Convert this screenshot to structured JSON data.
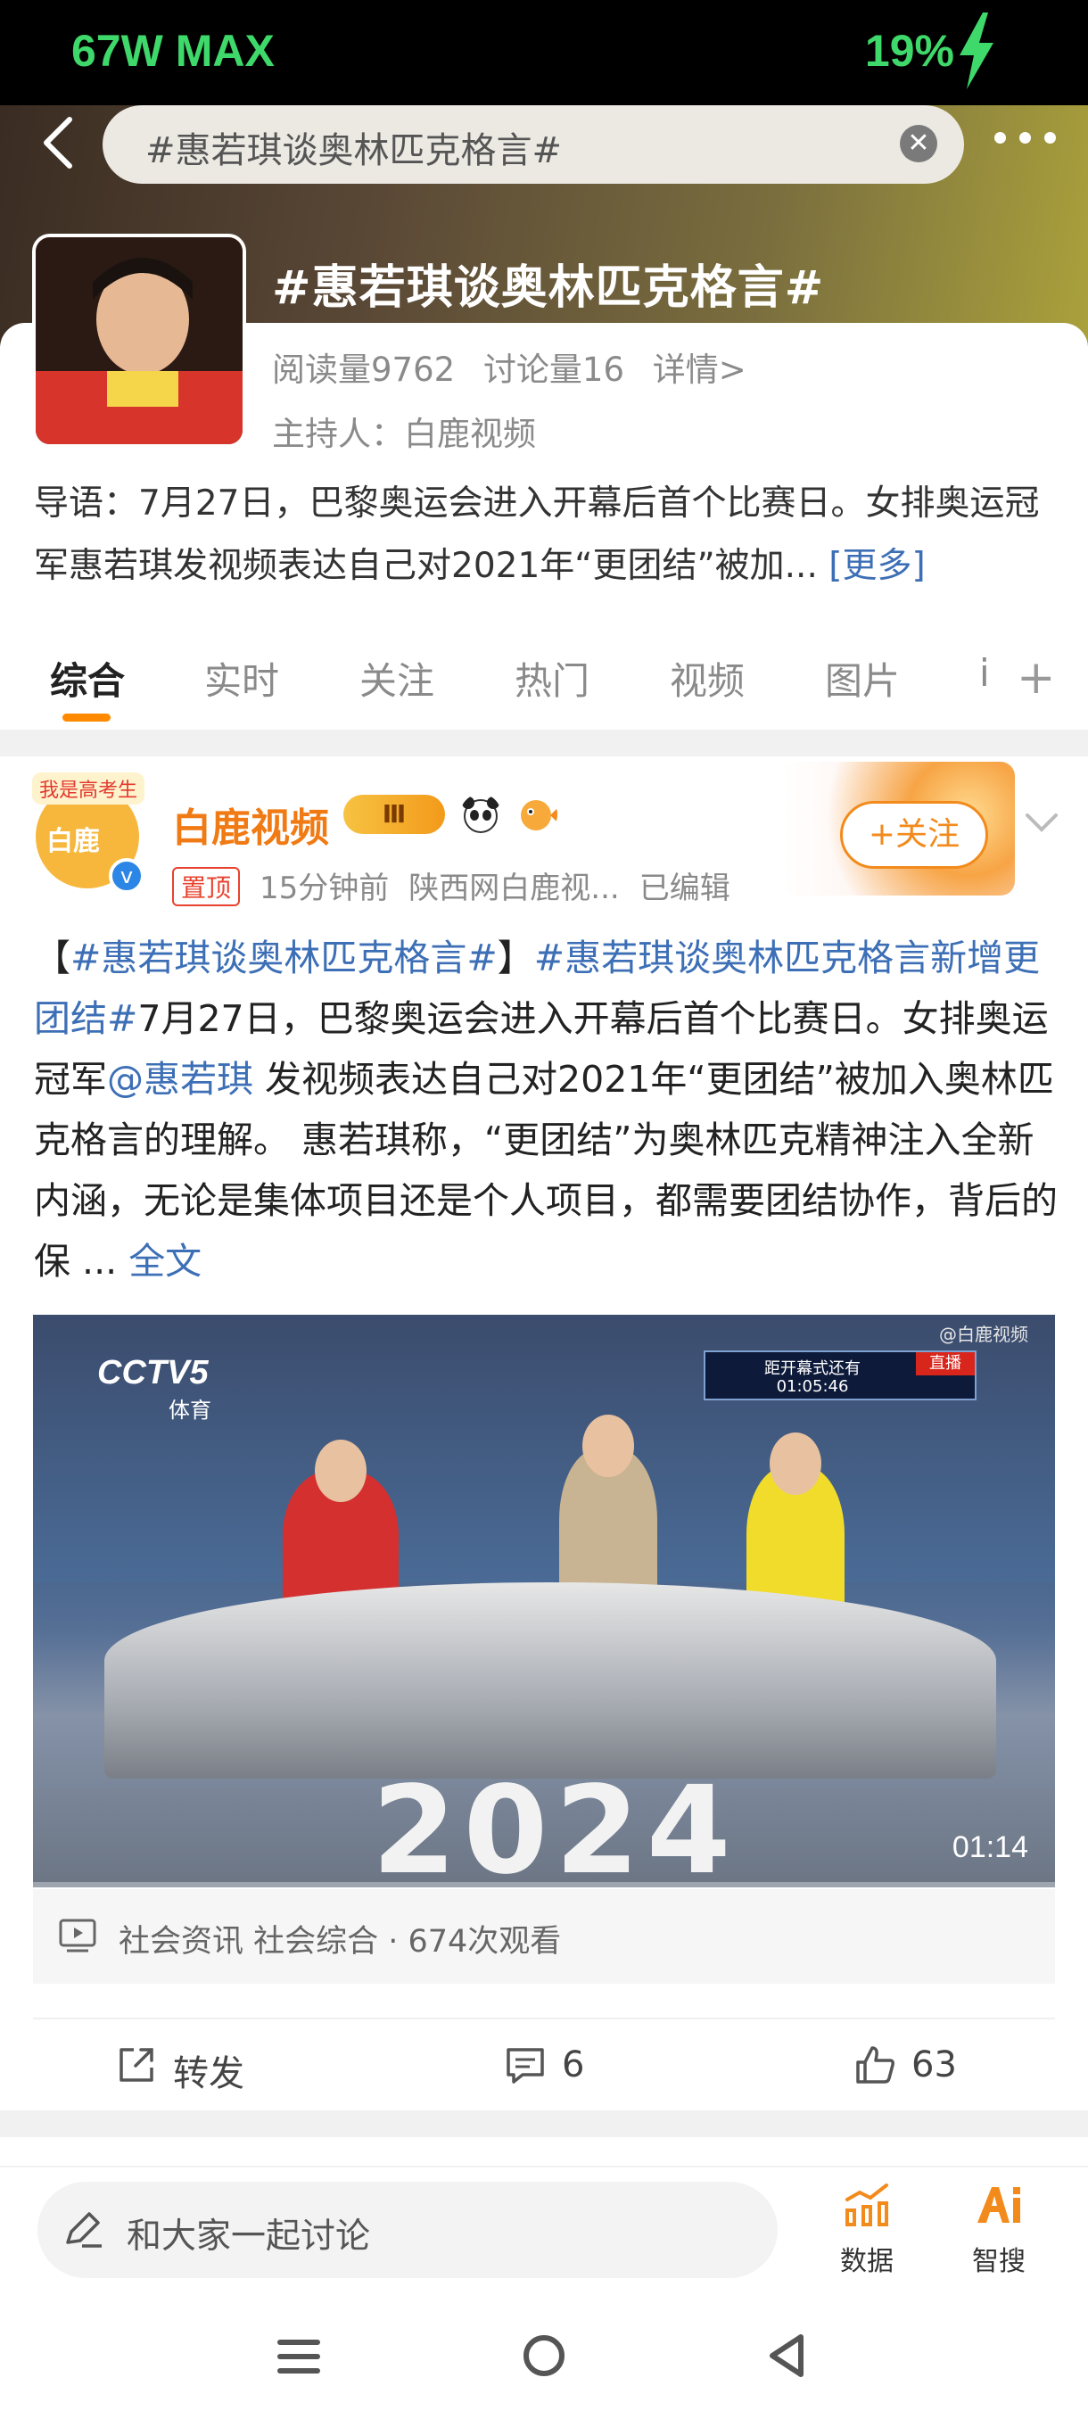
{
  "status_bar": {
    "left_text": "67W MAX",
    "battery": "19%"
  },
  "header": {
    "search_text": "#惠若琪谈奥林匹克格言#",
    "topic_title": "#惠若琪谈奥林匹克格言#",
    "reads": "阅读量9762",
    "discussions": "讨论量16",
    "details": "详情>",
    "host": "主持人：白鹿视频",
    "intro": "导语：7月27日，巴黎奥运会进入开幕后首个比赛日。女排奥运冠军惠若琪发视频表达自己对2021年“更团结”被加...",
    "intro_more": "[更多]"
  },
  "tabs": [
    "综合",
    "实时",
    "关注",
    "热门",
    "视频",
    "图片",
    "i"
  ],
  "post": {
    "author": "白鹿视频",
    "level_badge": "Ⅲ",
    "avatar_label": "白鹿",
    "avatar_ribbon": "我是高考生",
    "pin_label": "置顶",
    "time": "15分钟前",
    "source": "陕西网白鹿视...",
    "edited": "已编辑",
    "follow_label": "+关注",
    "text_bracket_open": "【",
    "text_tag1": "#惠若琪谈奥林匹克格言#",
    "text_bracket_close": "】",
    "text_tag2": "#惠若琪谈奥林匹克格言新增更团结#",
    "text_part1": "7月27日，巴黎奥运会进入开幕后首个比赛日。女排奥运冠军",
    "text_mention": "@惠若琪",
    "text_part2": " 发视频表达自己对2021年“更团结”被加入奥林匹克格言的理解。 惠若琪称，“更团结”为奥林匹克精神注入全新内涵，无论是集体项目还是个人项目，都需要团结协作，背后的保 ...",
    "full_text_link": "全文",
    "video": {
      "channel_logo": "CCTV5",
      "channel_sub": "体育",
      "watermark": "@白鹿视频",
      "countdown_title": "距开幕式还有",
      "countdown_time": "01:05:46",
      "live_label": "直播",
      "overlay_text": "2024",
      "duration": "01:14"
    },
    "video_info": "社会资讯 社会综合 · 674次观看",
    "repost_label": "转发",
    "comments": "6",
    "likes": "63"
  },
  "compose": {
    "placeholder": "和大家一起讨论",
    "tool_data": "数据",
    "tool_ai": "智搜"
  },
  "colors": {
    "accent_orange": "#f28a1c",
    "link_blue": "#3d6fb6",
    "status_green": "#3fd86a"
  }
}
